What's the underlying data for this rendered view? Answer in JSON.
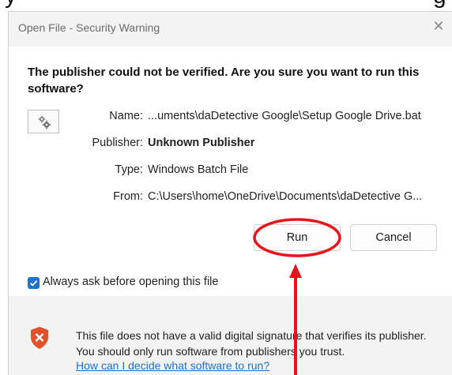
{
  "background_window": {
    "left_fragment": "y",
    "right_fragment": "g"
  },
  "dialog": {
    "title": "Open File - Security Warning",
    "close_glyph": "✕",
    "headline": "The publisher could not be verified.  Are you sure you want to run this software?",
    "icon": "gears-icon",
    "fields": [
      {
        "label": "Name:",
        "value": "...uments\\daDetective Google\\Setup Google Drive.bat",
        "bold": false
      },
      {
        "label": "Publisher:",
        "value": "Unknown Publisher",
        "bold": true
      },
      {
        "label": "Type:",
        "value": "Windows Batch File",
        "bold": false
      },
      {
        "label": "From:",
        "value": "C:\\Users\\home\\OneDrive\\Documents\\daDetective G...",
        "bold": false
      }
    ],
    "buttons": {
      "run": "Run",
      "cancel": "Cancel"
    },
    "checkbox": {
      "label": "Always ask before opening this file",
      "checked": true
    },
    "footer": {
      "icon": "shield-x-icon",
      "text": "This file does not have a valid digital signature that verifies its publisher.  You should only run software from publishers you trust.",
      "link": "How can I decide what software to run?"
    }
  },
  "colors": {
    "accent": "#1a73c8",
    "link": "#1a6fd0",
    "annotation": "#e8141b",
    "shield": "#e0522a"
  }
}
